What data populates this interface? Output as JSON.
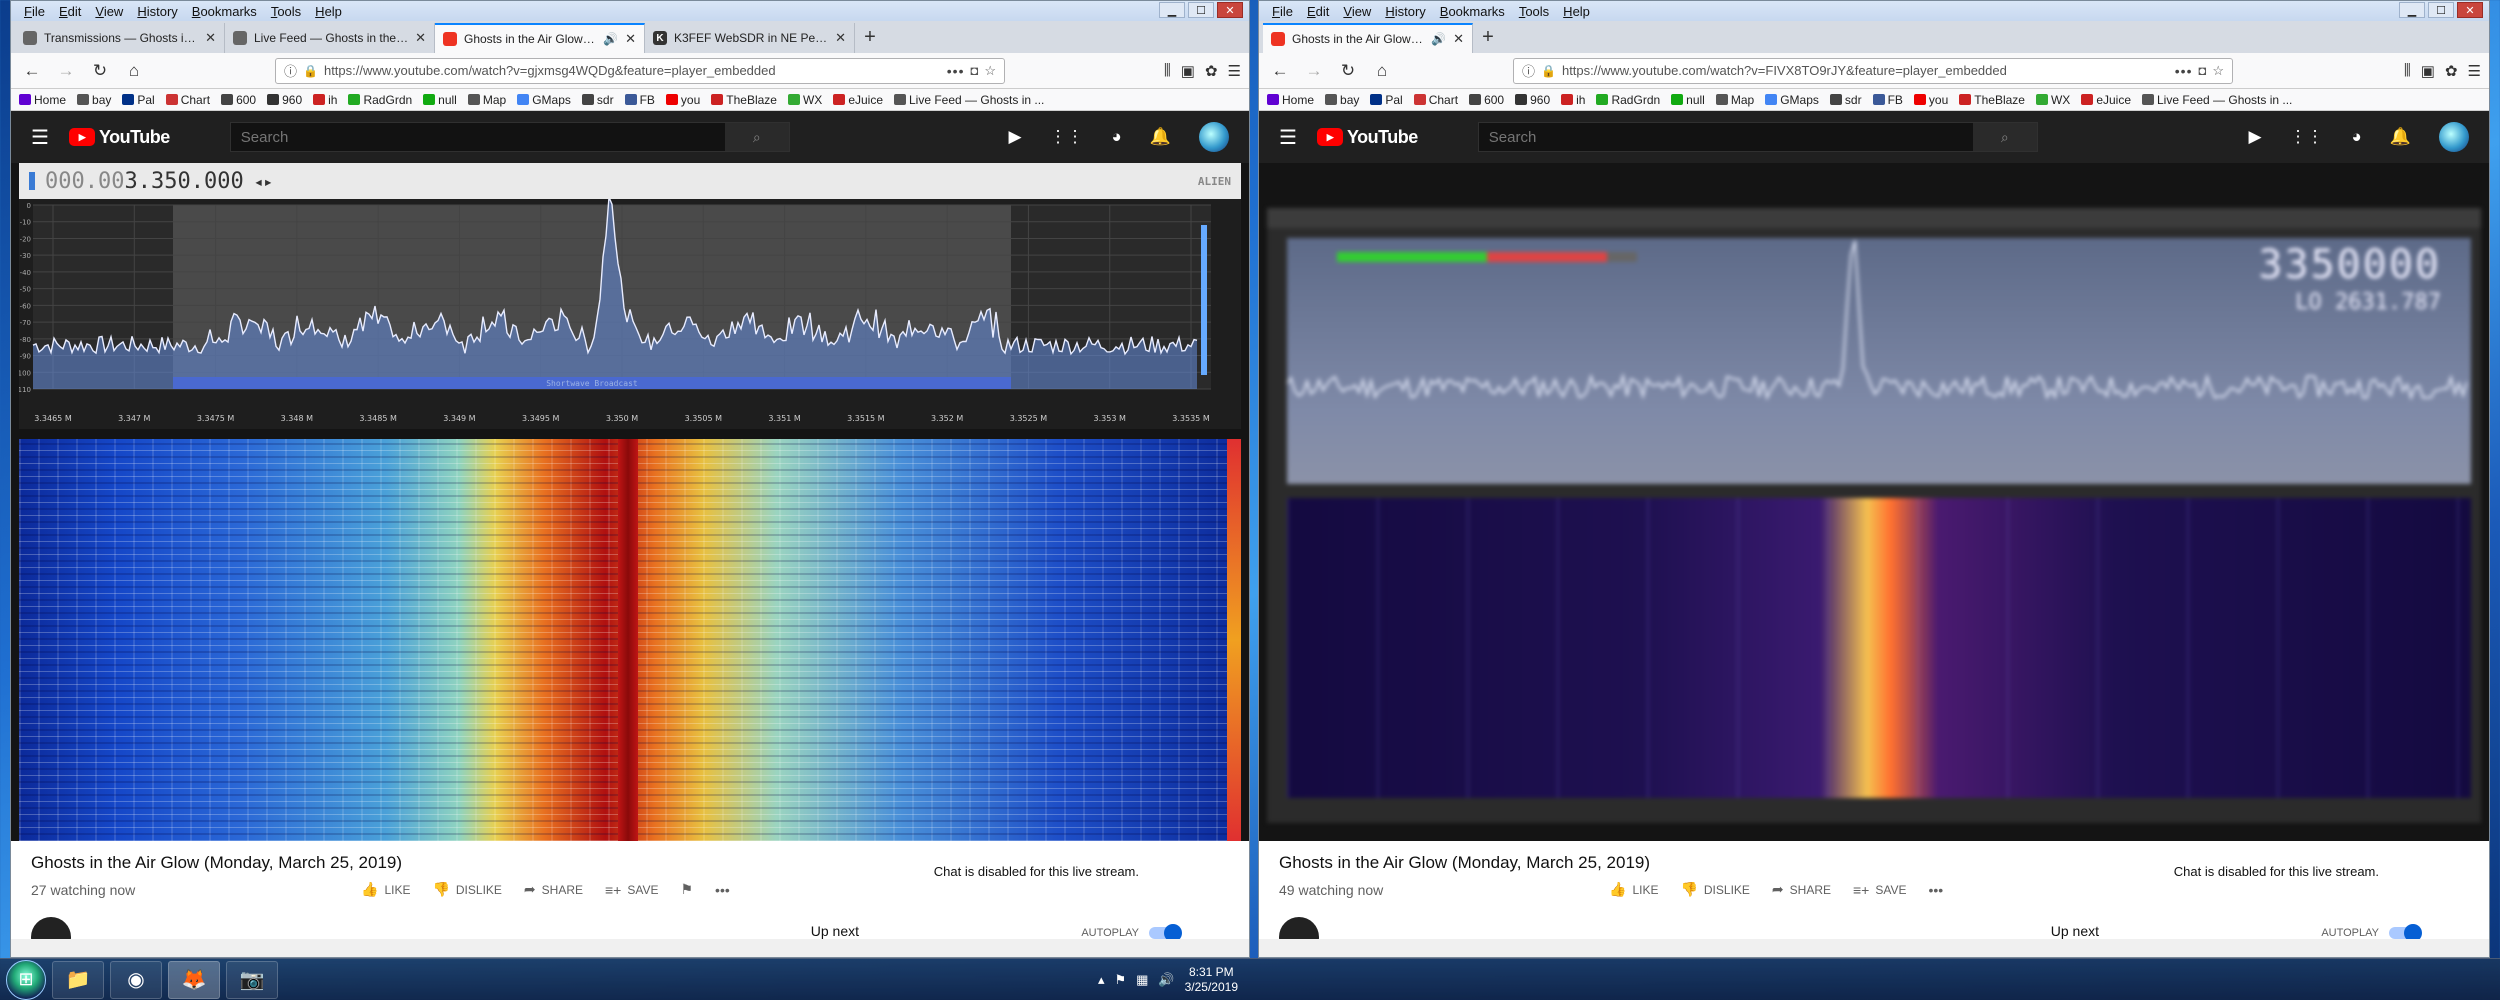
{
  "windows": [
    {
      "menu": [
        "File",
        "Edit",
        "View",
        "History",
        "Bookmarks",
        "Tools",
        "Help"
      ],
      "tabs": [
        {
          "title": "Transmissions — Ghosts in the",
          "favicon": "ghost-icon",
          "active": false
        },
        {
          "title": "Live Feed — Ghosts in the Air G",
          "favicon": "ghost-icon",
          "active": false
        },
        {
          "title": "Ghosts in the Air Glow (Mo",
          "favicon": "youtube-icon",
          "active": true
        },
        {
          "title": "K3FEF WebSDR in NE Pennsylv",
          "favicon": "k-icon",
          "active": false
        }
      ],
      "url": "https://www.youtube.com/watch?v=gjxmsg4WQDg&feature=player_embedded",
      "sdr_freq_dim": "000.00",
      "sdr_freq": "3.350.000",
      "sdr_brand": "ALIEN",
      "spectrum_label": "Shortwave Broadcast",
      "freq_ticks": [
        "3.3465 M",
        "3.347 M",
        "3.3475 M",
        "3.348 M",
        "3.3485 M",
        "3.349 M",
        "3.3495 M",
        "3.350 M",
        "3.3505 M",
        "3.351 M",
        "3.3515 M",
        "3.352 M",
        "3.3525 M",
        "3.353 M",
        "3.3535 M"
      ],
      "db_ticks": [
        "0",
        "-10",
        "-20",
        "-30",
        "-40",
        "-50",
        "-60",
        "-70",
        "-80",
        "-90",
        "-100",
        "-110"
      ],
      "video_title": "Ghosts in the Air Glow (Monday, March 25, 2019)",
      "watching": "27 watching now",
      "chat": "Chat is disabled for this live stream."
    },
    {
      "menu": [
        "File",
        "Edit",
        "View",
        "History",
        "Bookmarks",
        "Tools",
        "Help"
      ],
      "tabs": [
        {
          "title": "Ghosts in the Air Glow (Mo",
          "favicon": "youtube-icon",
          "active": true
        }
      ],
      "url": "https://www.youtube.com/watch?v=FIVX8TO9rJY&feature=player_embedded",
      "sdr_freq": "3350000",
      "sdr_lo": "LO    2631.787",
      "video_title": "Ghosts in the Air Glow (Monday, March 25, 2019)",
      "watching": "49 watching now",
      "chat": "Chat is disabled for this live stream."
    }
  ],
  "bookmarks": [
    {
      "label": "Home",
      "icon": "yahoo-icon",
      "color": "#6001d2"
    },
    {
      "label": "bay",
      "icon": "folder-icon",
      "color": "#555"
    },
    {
      "label": "Pal",
      "icon": "paypal-icon",
      "color": "#003087"
    },
    {
      "label": "Chart",
      "icon": "chart-icon",
      "color": "#c33"
    },
    {
      "label": "600",
      "icon": "globe-icon",
      "color": "#444"
    },
    {
      "label": "960",
      "icon": "grid-icon",
      "color": "#333"
    },
    {
      "label": "ih",
      "icon": "ih-icon",
      "color": "#c22"
    },
    {
      "label": "RadGrdn",
      "icon": "dot-icon",
      "color": "#2a2"
    },
    {
      "label": "null",
      "icon": "null-icon",
      "color": "#1a1"
    },
    {
      "label": "Map",
      "icon": "map-icon",
      "color": "#555"
    },
    {
      "label": "GMaps",
      "icon": "google-icon",
      "color": "#4285f4"
    },
    {
      "label": "sdr",
      "icon": "globe-icon",
      "color": "#444"
    },
    {
      "label": "FB",
      "icon": "facebook-icon",
      "color": "#3b5998"
    },
    {
      "label": "you",
      "icon": "youtube-icon",
      "color": "#e00"
    },
    {
      "label": "TheBlaze",
      "icon": "blaze-icon",
      "color": "#c22"
    },
    {
      "label": "WX",
      "icon": "weather-icon",
      "color": "#3a3"
    },
    {
      "label": "eJuice",
      "icon": "juice-icon",
      "color": "#c22"
    },
    {
      "label": "Live Feed — Ghosts in ...",
      "icon": "ghost-icon",
      "color": "#555"
    }
  ],
  "youtube": {
    "brand": "YouTube",
    "search_placeholder": "Search"
  },
  "actions": {
    "like": "LIKE",
    "dislike": "DISLIKE",
    "share": "SHARE",
    "save": "SAVE"
  },
  "upnext": "Up next",
  "autoplay": "AUTOPLAY",
  "taskbar": {
    "time": "8:31 PM",
    "date": "3/25/2019"
  },
  "colors": {
    "yt_header": "#202020",
    "accent": "#0a84ff",
    "waterfall_carrier": "#c01515"
  }
}
